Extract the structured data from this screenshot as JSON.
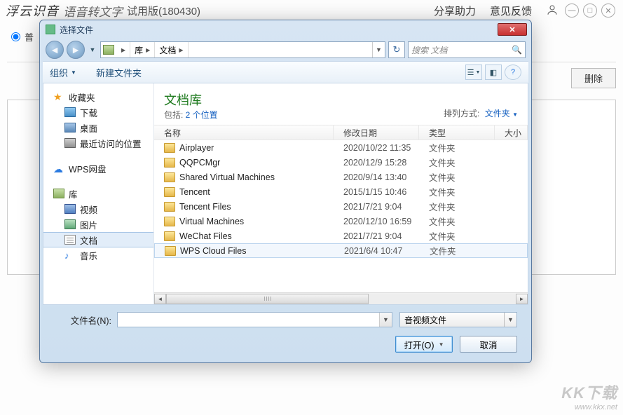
{
  "app": {
    "brand": "浮云识音",
    "subtitle": "语音转文字",
    "version": "试用版(180430)",
    "share": "分享助力",
    "feedback": "意见反馈",
    "radio_local": "普",
    "delete_btn": "删除"
  },
  "dialog": {
    "title": "选择文件",
    "breadcrumb": {
      "root": "库",
      "cur": "文档"
    },
    "search_placeholder": "搜索 文档",
    "toolbar": {
      "organize": "组织",
      "new_folder": "新建文件夹"
    },
    "sidebar": {
      "fav": "收藏夹",
      "fav_items": [
        "下载",
        "桌面",
        "最近访问的位置"
      ],
      "wps": "WPS网盘",
      "lib": "库",
      "lib_items": [
        "视频",
        "图片",
        "文档",
        "音乐"
      ]
    },
    "library": {
      "title": "文档库",
      "sub_prefix": "包括: ",
      "sub_link": "2 个位置",
      "arrange_lbl": "排列方式:",
      "arrange_val": "文件夹"
    },
    "columns": {
      "name": "名称",
      "date": "修改日期",
      "type": "类型",
      "size": "大小"
    },
    "rows": [
      {
        "name": "Airplayer",
        "date": "2020/10/22 11:35",
        "type": "文件夹"
      },
      {
        "name": "QQPCMgr",
        "date": "2020/12/9 15:28",
        "type": "文件夹"
      },
      {
        "name": "Shared Virtual Machines",
        "date": "2020/9/14 13:40",
        "type": "文件夹"
      },
      {
        "name": "Tencent",
        "date": "2015/1/15 10:46",
        "type": "文件夹"
      },
      {
        "name": "Tencent Files",
        "date": "2021/7/21 9:04",
        "type": "文件夹"
      },
      {
        "name": "Virtual Machines",
        "date": "2020/12/10 16:59",
        "type": "文件夹"
      },
      {
        "name": "WeChat Files",
        "date": "2021/7/21 9:04",
        "type": "文件夹"
      },
      {
        "name": "WPS Cloud Files",
        "date": "2021/6/4 10:47",
        "type": "文件夹"
      }
    ],
    "filename_lbl": "文件名(N):",
    "filetype": "音视频文件",
    "open_btn": "打开(O)",
    "cancel_btn": "取消"
  },
  "watermark": {
    "big": "KK下载",
    "url": "www.kkx.net"
  }
}
